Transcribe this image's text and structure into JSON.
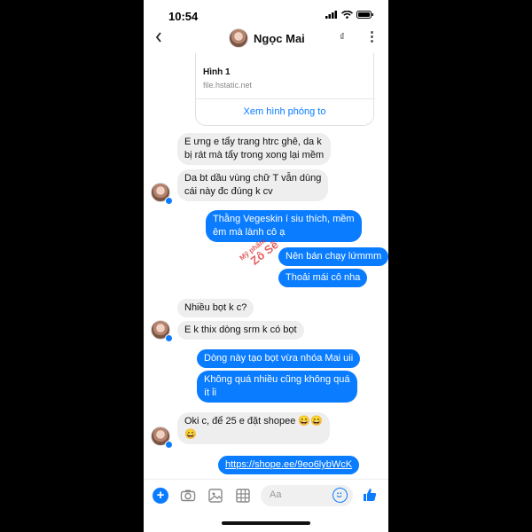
{
  "status": {
    "time": "10:54"
  },
  "header": {
    "name": "Ngọc Mai",
    "currency_glyph": "₫"
  },
  "link_card": {
    "title": "Hình 1",
    "domain": "file.hstatic.net",
    "action": "Xem hình phóng to"
  },
  "messages": [
    {
      "dir": "in",
      "text": "E ưng e tẩy trang htrc ghê, da k\nbị rát mà tẩy trong xong lại mềm"
    },
    {
      "dir": "in",
      "text": "Da bt dầu vùng chữ T vẫn dùng\ncái này đc đúng k cv"
    },
    {
      "dir": "out",
      "text": "Thằng Vegeskin í siu thích, mềm\nêm mà lành cô ạ"
    },
    {
      "dir": "out",
      "text": "Nên bán chạy lứmmm"
    },
    {
      "dir": "out",
      "text": "Thoải mái cô nha"
    },
    {
      "dir": "in",
      "text": "Nhiều bọt k c?"
    },
    {
      "dir": "in",
      "text": "E k thix dòng srm k có bọt"
    },
    {
      "dir": "out",
      "text": "Dòng này tạo bọt vừa nhóa Mai uii"
    },
    {
      "dir": "out",
      "text": "Không quá nhiều cũng không quá\nít ỉi"
    },
    {
      "dir": "in",
      "text": "Oki c, để 25 e đặt shopee 😄😄\n😄"
    },
    {
      "dir": "out",
      "text": "https://shope.ee/9eo6lybWcK"
    }
  ],
  "watermark": {
    "line1": "Mỹ phẩm",
    "line2": "Zô Sẽ"
  },
  "composer": {
    "placeholder": "Aa"
  },
  "colors": {
    "messenger_blue": "#0a7cff",
    "incoming_bubble": "#eeeeee"
  }
}
